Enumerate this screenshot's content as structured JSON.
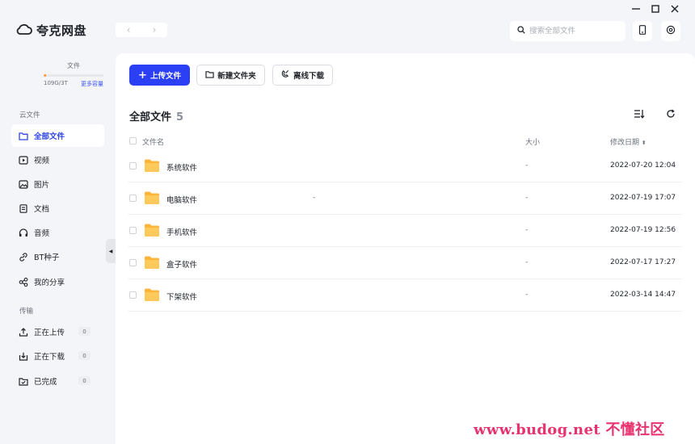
{
  "app": {
    "title": "夸克网盘"
  },
  "search": {
    "placeholder": "搜索全部文件"
  },
  "sidebar": {
    "storage": {
      "label": "文件",
      "used": "109G/3T",
      "more": "更多容量",
      "fill_percent": 3.6
    },
    "cloud_title": "云文件",
    "items": [
      {
        "label": "全部文件",
        "icon": "folder-icon",
        "active": true
      },
      {
        "label": "视频",
        "icon": "video-icon"
      },
      {
        "label": "图片",
        "icon": "image-icon"
      },
      {
        "label": "文档",
        "icon": "document-icon"
      },
      {
        "label": "音频",
        "icon": "headphones-icon"
      },
      {
        "label": "BT种子",
        "icon": "link-icon"
      },
      {
        "label": "我的分享",
        "icon": "share-icon"
      }
    ],
    "transfer_title": "传输",
    "transfers": [
      {
        "label": "正在上传",
        "count": "0",
        "icon": "upload-icon"
      },
      {
        "label": "正在下载",
        "count": "0",
        "icon": "download-icon"
      },
      {
        "label": "已完成",
        "count": "0",
        "icon": "completed-icon"
      }
    ]
  },
  "toolbar": {
    "upload_label": "上传文件",
    "new_folder_label": "新建文件夹",
    "offline_label": "离线下载"
  },
  "main": {
    "title": "全部文件",
    "count": "5",
    "columns": {
      "name": "文件名",
      "size": "大小",
      "date": "修改日期"
    },
    "files": [
      {
        "name": "系统软件",
        "extra": "",
        "size": "-",
        "date": "2022-07-20 12:04"
      },
      {
        "name": "电脑软件",
        "extra": "-",
        "size": "-",
        "date": "2022-07-19 17:07"
      },
      {
        "name": "手机软件",
        "extra": "",
        "size": "-",
        "date": "2022-07-19 12:56"
      },
      {
        "name": "盒子软件",
        "extra": "",
        "size": "-",
        "date": "2022-07-17 17:27"
      },
      {
        "name": "下架软件",
        "extra": "",
        "size": "-",
        "date": "2022-03-14 14:47"
      }
    ]
  },
  "colors": {
    "accent": "#2b3ff5",
    "folder": "#ffc14d",
    "storage_fill": "#ff9e3d"
  },
  "watermark": {
    "text": "www.budog.net 不懂社区"
  }
}
